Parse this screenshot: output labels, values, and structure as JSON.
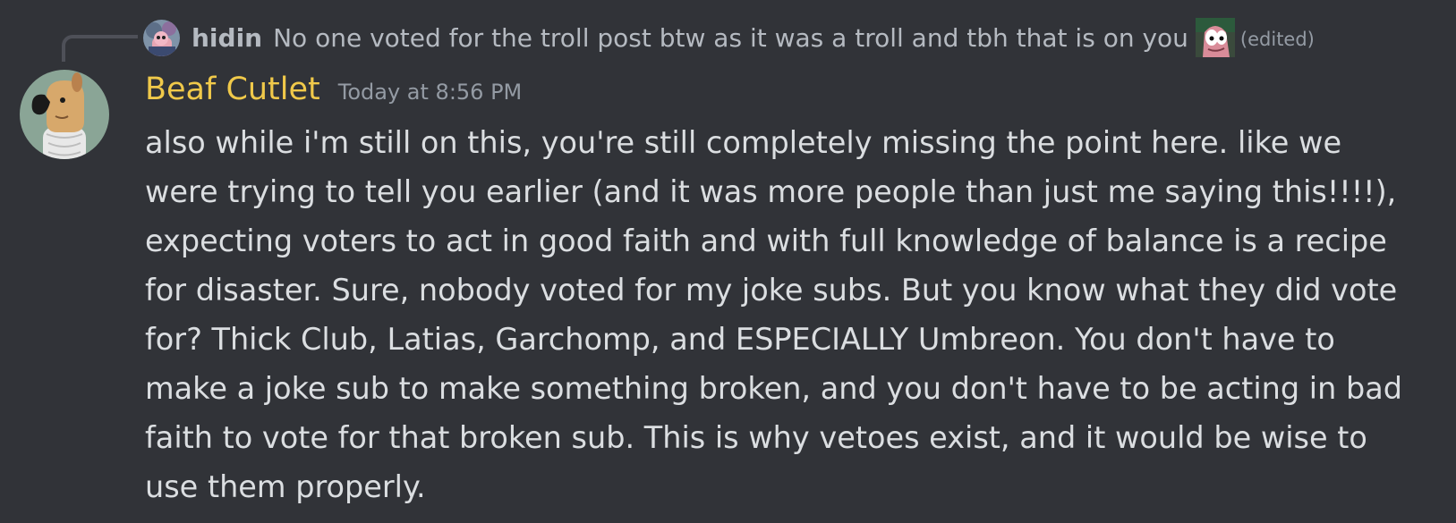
{
  "reply": {
    "author": "hidin",
    "text": "No one voted for the troll post btw as it was a troll and tbh that is on you",
    "emoji": "patrick-emoji",
    "edited": "(edited)"
  },
  "message": {
    "author": "Beaf Cutlet",
    "author_color": "#f0c94a",
    "timestamp": "Today at 8:56 PM",
    "lines": [
      "also while i'm still on this, you're still completely missing the point here. like we",
      "were trying to tell you earlier (and it was more people than just me saying this!!!!),",
      "expecting voters to act in good faith and with full knowledge of balance is a recipe",
      "for disaster. Sure, nobody voted for my joke subs. But you know what they did vote",
      "for? Thick Club, Latias, Garchomp, and ESPECIALLY Umbreon. You don't have to",
      "make a joke sub to make something broken, and you don't have to be acting in bad",
      "faith to vote for that broken sub. This is why vetoes exist, and it would be wise to",
      "use them properly."
    ]
  },
  "colors": {
    "background": "#313338",
    "text": "#dbdee1",
    "muted": "#949ba4",
    "reply_text": "#b5bac1"
  }
}
